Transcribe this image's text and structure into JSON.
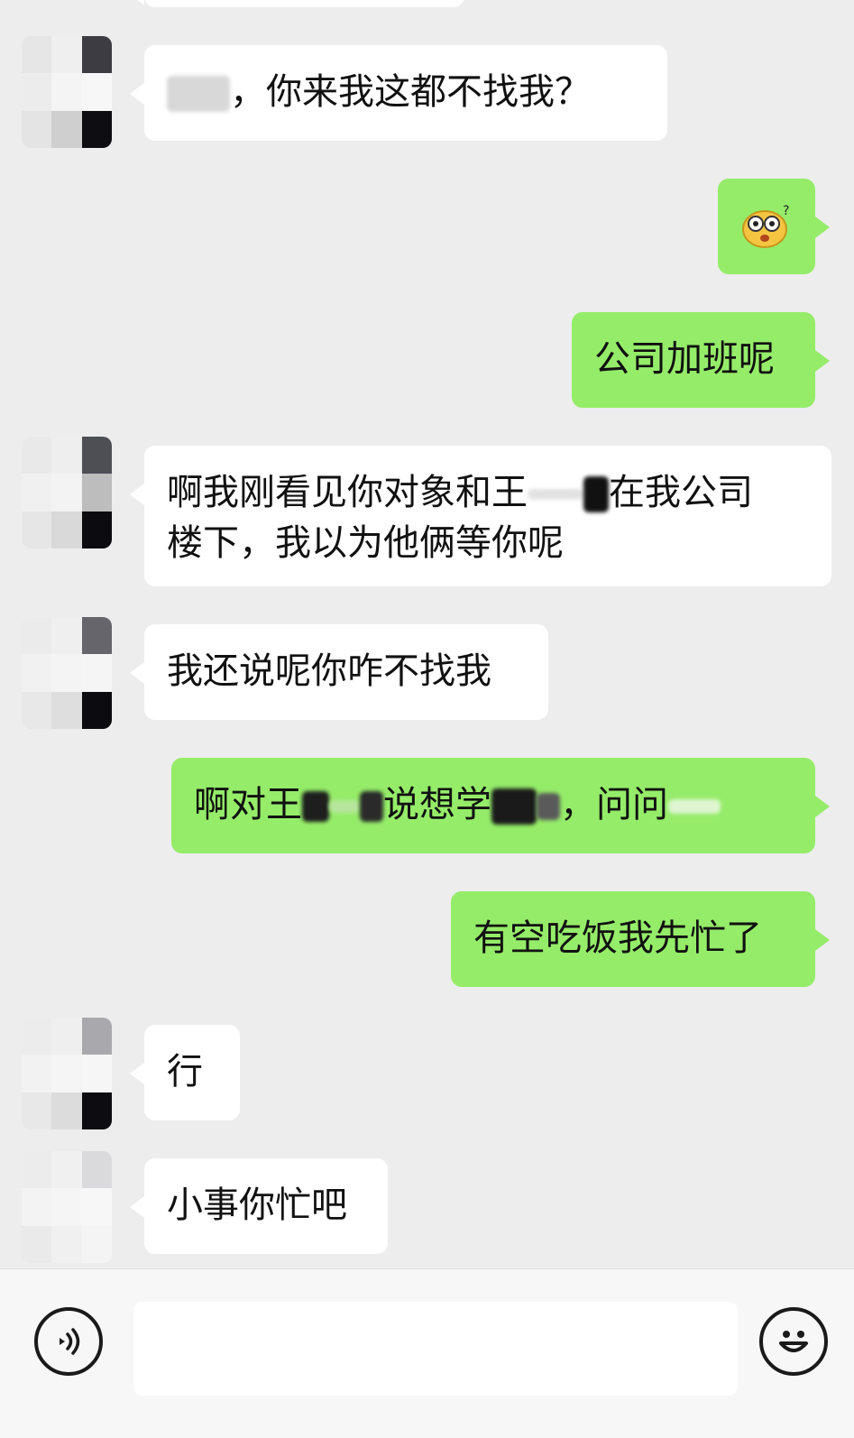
{
  "messages": [
    {
      "side": "in",
      "text": "，你来我这都不找我？"
    },
    {
      "side": "out",
      "icon": "confused-emoji-icon"
    },
    {
      "side": "out",
      "text": "公司加班呢"
    },
    {
      "side": "in",
      "line1a": "啊我刚看见你对象和王",
      "line1b": "在我公司",
      "line2": "楼下，我以为他俩等你呢"
    },
    {
      "side": "in",
      "text": "我还说呢你咋不找我"
    },
    {
      "side": "out",
      "p1": "啊对王",
      "p2": "说想学",
      "p3": "，问问"
    },
    {
      "side": "out",
      "text": "有空吃饭我先忙了"
    },
    {
      "side": "in",
      "text": "行"
    },
    {
      "side": "in",
      "text": "小事你忙吧"
    }
  ],
  "input_bar": {
    "voice_icon": "voice-icon",
    "emoji_icon": "smiley-icon"
  },
  "colors": {
    "background": "#ededed",
    "incoming_bubble": "#ffffff",
    "outgoing_bubble": "#95ec69"
  }
}
